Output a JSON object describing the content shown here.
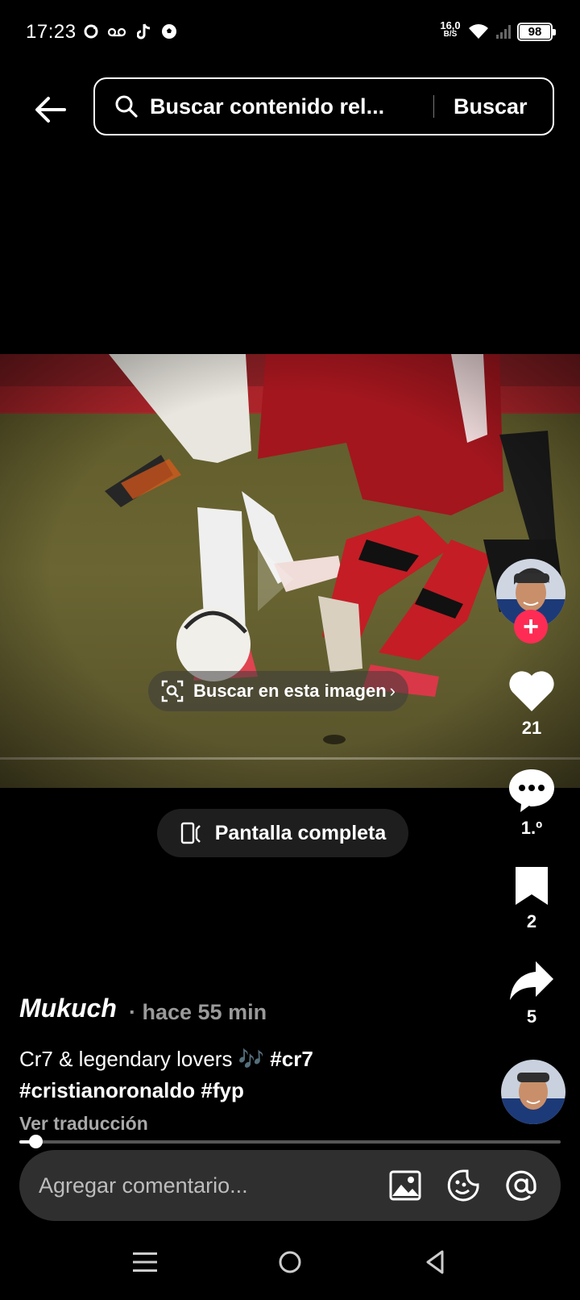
{
  "status_bar": {
    "time": "17:23",
    "net_speed_value": "16,0",
    "net_speed_unit": "B/S",
    "battery": "98",
    "notification_icons": [
      "sync-icon",
      "voicemail-icon",
      "tiktok-icon",
      "soccer-ball-icon"
    ]
  },
  "search": {
    "query": "Buscar contenido rel...",
    "button_label": "Buscar"
  },
  "video": {
    "image_search_label": "Buscar en esta imagen",
    "fullscreen_label": "Pantalla completa",
    "progress": 0.03
  },
  "actions": {
    "likes": "21",
    "comments": "1.º",
    "saves": "2",
    "shares": "5"
  },
  "post": {
    "author": "Mukuch",
    "time": "· hace 55 min",
    "caption_text": "Cr7 & legendary lovers 🎶",
    "hashtags": [
      "#cr7",
      "#cristianoronaldo",
      "#fyp"
    ],
    "translate_label": "Ver traducción"
  },
  "comment_bar": {
    "placeholder": "Agregar comentario..."
  },
  "colors": {
    "accent": "#fe2c55",
    "background": "#000000",
    "comment_bar": "#2f2f2f"
  }
}
